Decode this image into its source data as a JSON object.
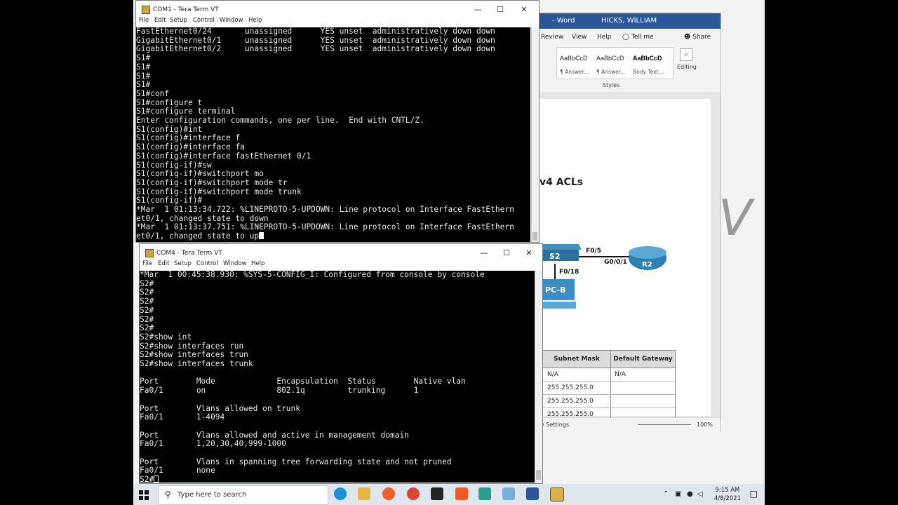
{
  "word": {
    "title": "- Word",
    "user": "HICKS, WILLIAM",
    "tabs": [
      "Review",
      "View",
      "Help",
      "Tell me",
      "Share"
    ],
    "styles": [
      {
        "preview": "AaBbCcD",
        "name": "¶ Answer..."
      },
      {
        "preview": "AaBbCcD",
        "name": "¶ Answer..."
      },
      {
        "preview": "AaBbCcD",
        "name": "Body Text..."
      }
    ],
    "styles_label": "Styles",
    "editing_label": "Editing",
    "doc_heading": "v4 ACLs",
    "diagram": {
      "s2": "S2",
      "r2": "R2",
      "pcb": "PC-B",
      "f05": "F0/5",
      "g001": "G0/0/1",
      "f018": "F0/18"
    },
    "table": {
      "headers": [
        "Subnet Mask",
        "Default Gateway"
      ],
      "rows": [
        [
          "N/A",
          "N/A"
        ],
        [
          "255.255.255.0",
          ""
        ],
        [
          "255.255.255.0",
          ""
        ],
        [
          "255.255.255.0",
          ""
        ]
      ]
    },
    "status": {
      "left": "y Settings",
      "zoom": "100%"
    }
  },
  "bg_letter": "V",
  "com1": {
    "title": "COM1 - Tera Term VT",
    "menu": [
      "File",
      "Edit",
      "Setup",
      "Control",
      "Window",
      "Help"
    ],
    "lines": [
      "FastEthernet0/24       unassigned      YES unset  administratively down down",
      "GigabitEthernet0/1     unassigned      YES unset  administratively down down",
      "GigabitEthernet0/2     unassigned      YES unset  administratively down down",
      "S1#",
      "S1#",
      "S1#",
      "S1#",
      "S1#conf",
      "S1#configure t",
      "S1#configure terminal",
      "Enter configuration commands, one per line.  End with CNTL/Z.",
      "S1(config)#int",
      "S1(config)#interface f",
      "S1(config)#interface fa",
      "S1(config)#interface fastEthernet 0/1",
      "S1(config-if)#sw",
      "S1(config-if)#switchport mo",
      "S1(config-if)#switchport mode tr",
      "S1(config-if)#switchport mode trunk",
      "S1(config-if)#",
      "*Mar  1 01:13:34.722: %LINEPROTO-5-UPDOWN: Line protocol on Interface FastEthern",
      "et0/1, changed state to down",
      "*Mar  1 01:13:37.751: %LINEPROTO-5-UPDOWN: Line protocol on Interface FastEthern",
      "et0/1, changed state to up"
    ]
  },
  "com4": {
    "title": "COM4 - Tera Term VT",
    "menu": [
      "File",
      "Edit",
      "Setup",
      "Control",
      "Window",
      "Help"
    ],
    "lines": [
      "*Mar  1 00:45:38.930: %SYS-5-CONFIG_I: Configured from console by console",
      "S2#",
      "S2#",
      "S2#",
      "S2#",
      "S2#",
      "S2#",
      "S2#show int",
      "S2#show interfaces run",
      "S2#show interfaces trun",
      "S2#show interfaces trunk",
      "",
      "Port        Mode             Encapsulation  Status        Native vlan",
      "Fa0/1       on               802.1q         trunking      1",
      "",
      "Port        Vlans allowed on trunk",
      "Fa0/1       1-4094",
      "",
      "Port        Vlans allowed and active in management domain",
      "Fa0/1       1,20,30,40,999-1000",
      "",
      "Port        Vlans in spanning tree forwarding state and not pruned",
      "Fa0/1       none",
      "S2#"
    ]
  },
  "taskbar": {
    "search_placeholder": "Type here to search",
    "time": "9:15 AM",
    "date": "4/8/2021",
    "apps": [
      "edge",
      "explorer",
      "firefox",
      "chrome",
      "terminal",
      "brave",
      "store",
      "notepad",
      "word",
      "teraterm"
    ]
  }
}
